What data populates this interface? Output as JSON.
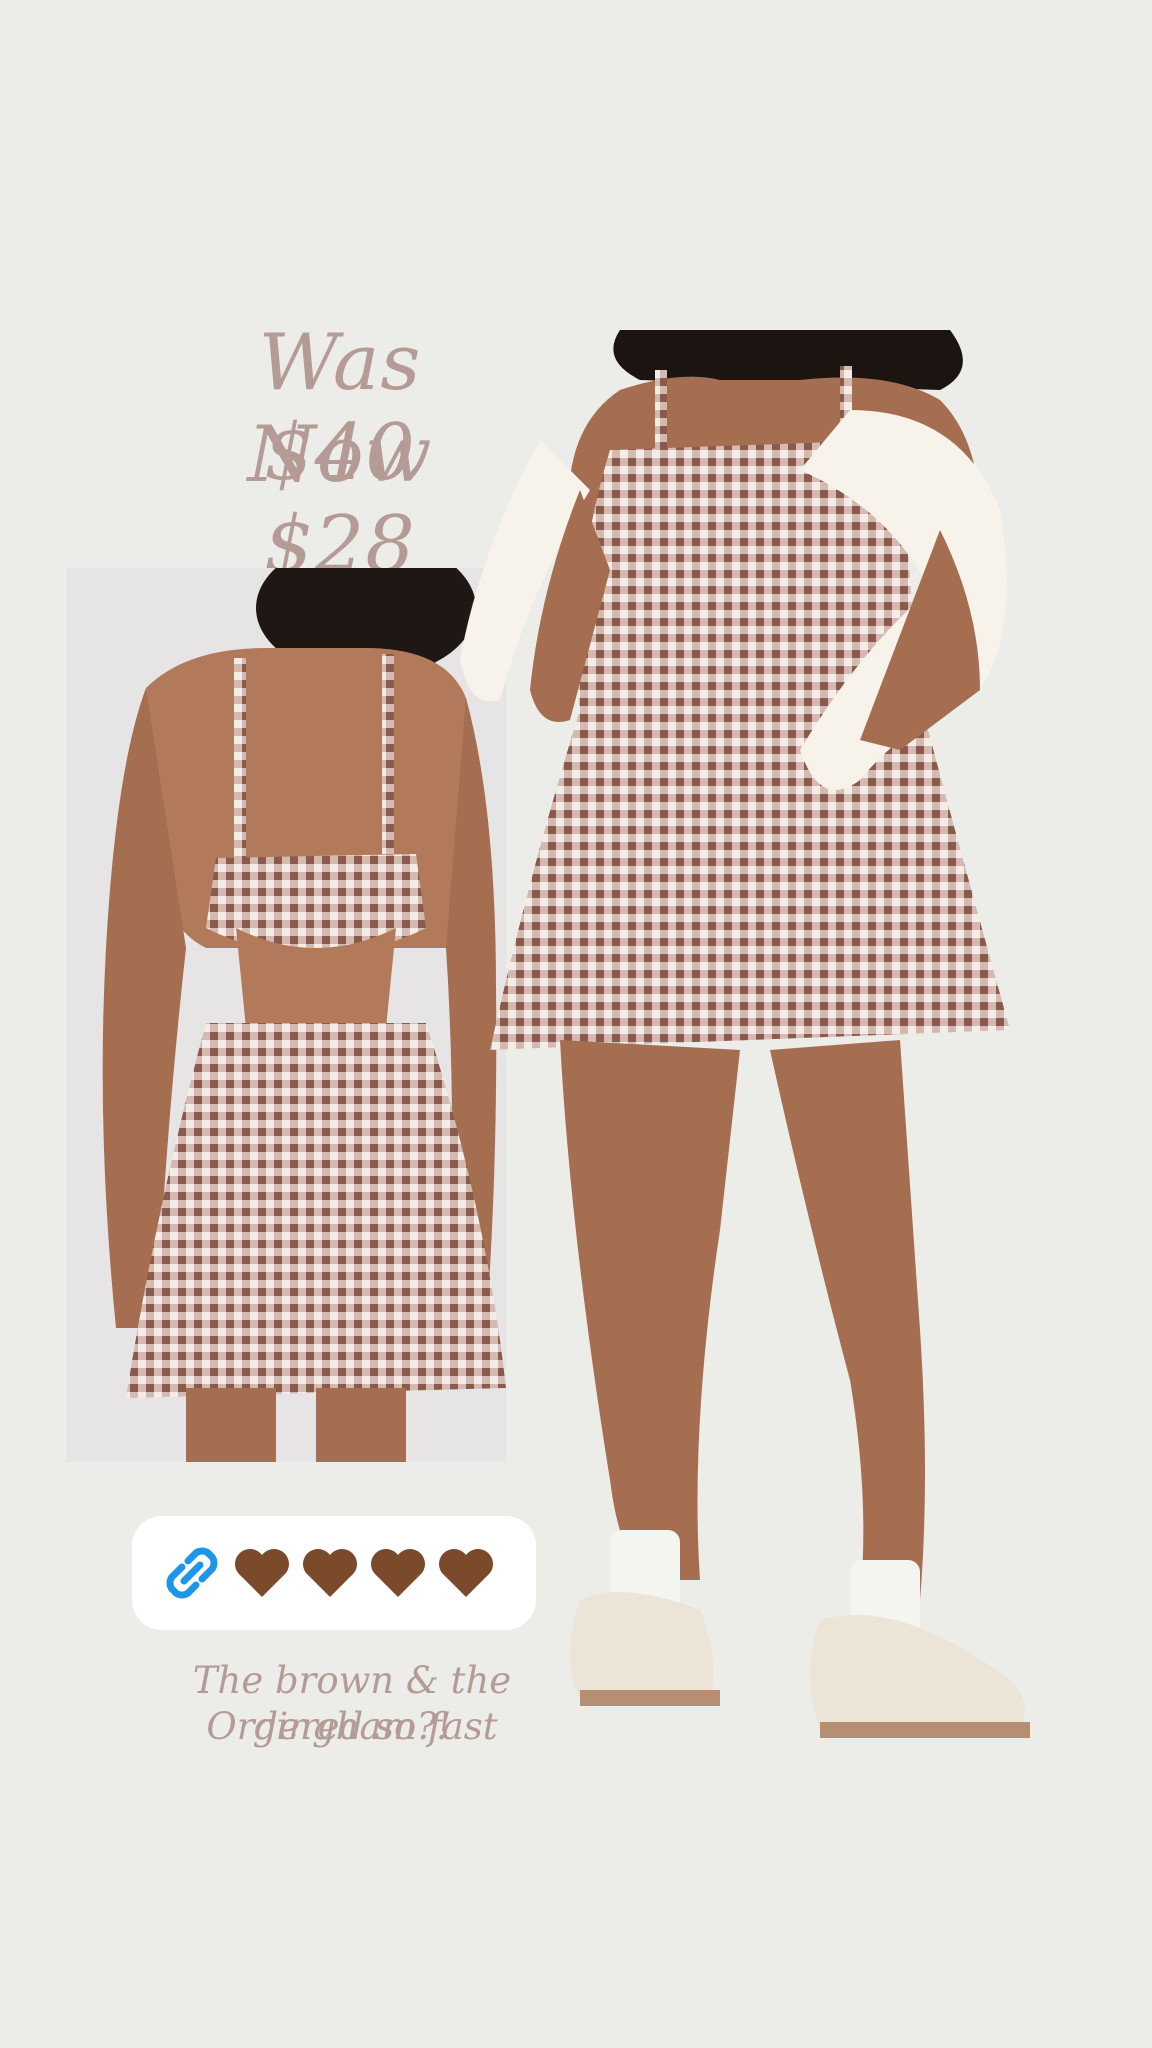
{
  "price": {
    "was": "Was $40",
    "now": "Now $28"
  },
  "link_sticker": {
    "icon": "link-icon",
    "hearts": [
      "brown-heart-icon",
      "brown-heart-icon",
      "brown-heart-icon",
      "brown-heart-icon"
    ]
  },
  "caption": {
    "line1": "The brown & the gingham?!",
    "line2": "Ordered so fast"
  },
  "colors": {
    "background": "#ecece9",
    "text": "#b59b95",
    "link_blue": "#1c96e8",
    "heart_brown": "#7a4a2a",
    "gingham_brown": "#8a5a4c",
    "gingham_cream": "#f4ece6"
  }
}
